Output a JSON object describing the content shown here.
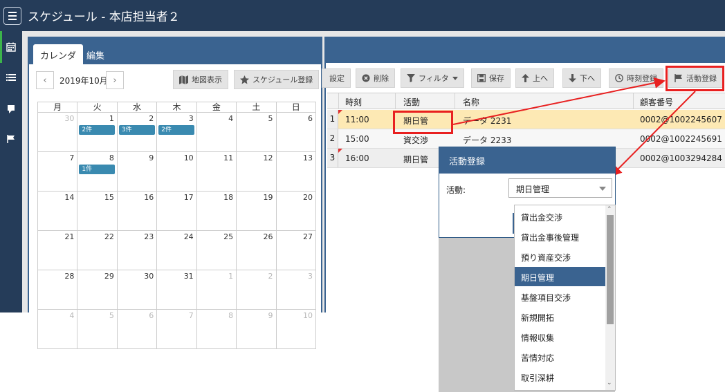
{
  "titlebar": {
    "title": "スケジュール - 本店担当者２",
    "menu_icon": "hamburger-icon"
  },
  "rail": {
    "icons": [
      "calendar-icon",
      "list-icon",
      "note-icon",
      "flag-icon"
    ],
    "active_color": "#3cb44b"
  },
  "calendar_panel": {
    "tabs": [
      "カレンダ",
      "編集"
    ],
    "month": "2019年10月",
    "prev": "‹",
    "next": "›",
    "map_button": "地図表示",
    "schedule_button": "スケジュール登録",
    "weekdays": [
      "月",
      "火",
      "水",
      "木",
      "金",
      "土",
      "日"
    ],
    "weeks": [
      [
        {
          "d": "30",
          "o": true
        },
        {
          "d": "1",
          "b": "2件"
        },
        {
          "d": "2",
          "b": "3件"
        },
        {
          "d": "3",
          "b": "2件"
        },
        {
          "d": "4"
        },
        {
          "d": "5"
        },
        {
          "d": "6"
        }
      ],
      [
        {
          "d": "7"
        },
        {
          "d": "8",
          "b": "1件"
        },
        {
          "d": "9"
        },
        {
          "d": "10"
        },
        {
          "d": "11"
        },
        {
          "d": "12"
        },
        {
          "d": "13"
        }
      ],
      [
        {
          "d": "14"
        },
        {
          "d": "15"
        },
        {
          "d": "16"
        },
        {
          "d": "17"
        },
        {
          "d": "18"
        },
        {
          "d": "19"
        },
        {
          "d": "20"
        }
      ],
      [
        {
          "d": "21"
        },
        {
          "d": "22"
        },
        {
          "d": "23"
        },
        {
          "d": "24"
        },
        {
          "d": "25"
        },
        {
          "d": "26"
        },
        {
          "d": "27"
        }
      ],
      [
        {
          "d": "28"
        },
        {
          "d": "29"
        },
        {
          "d": "30"
        },
        {
          "d": "31"
        },
        {
          "d": "1",
          "o": true
        },
        {
          "d": "2",
          "o": true
        },
        {
          "d": "3",
          "o": true
        }
      ],
      [
        {
          "d": "4",
          "o": true
        },
        {
          "d": "5",
          "o": true
        },
        {
          "d": "6",
          "o": true
        },
        {
          "d": "7",
          "o": true
        },
        {
          "d": "8",
          "o": true
        },
        {
          "d": "9",
          "o": true
        },
        {
          "d": "10",
          "o": true
        }
      ]
    ]
  },
  "schedule_panel": {
    "toolbar": {
      "settings": "設定",
      "delete": "削除",
      "filter": "フィルタ",
      "save": "保存",
      "up": "上へ",
      "down": "下へ",
      "time_register": "時刻登録",
      "activity_register": "活動登録"
    },
    "columns": [
      "時刻",
      "活動",
      "名称",
      "顧客番号"
    ],
    "rows": [
      {
        "n": "1",
        "time": "11:00",
        "activity": "期日管",
        "name": "データ 2231",
        "customer": "0002@1002245607"
      },
      {
        "n": "2",
        "time": "15:00",
        "activity": "資交渉",
        "name": "データ 2233",
        "customer": "0002@1002245691"
      },
      {
        "n": "3",
        "time": "16:00",
        "activity": "期日管",
        "name": "",
        "customer": "0002@1003294284"
      }
    ],
    "selected_row_color": "#fde9b4"
  },
  "dialog": {
    "title": "活動登録",
    "label": "活動:",
    "value": "期日管理",
    "options": [
      "貸出金交渉",
      "貸出金事後管理",
      "預り資産交渉",
      "期日管理",
      "基盤項目交渉",
      "新規開拓",
      "情報収集",
      "苦情対応",
      "取引深耕"
    ],
    "selected": "期日管理"
  },
  "annotation_color": "#e82020"
}
